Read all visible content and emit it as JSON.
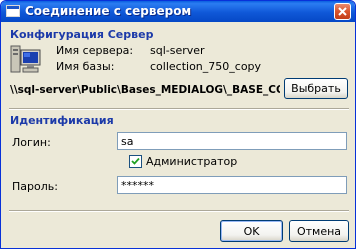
{
  "window": {
    "title": "Соединение с сервером"
  },
  "config": {
    "section_title": "Конфигурация Сервер",
    "server_label": "Имя сервера:",
    "server_value": "sql-server",
    "db_label": "Имя базы:",
    "db_value": "collection_750_copy",
    "path": "\\\\sql-server\\Public\\Bases_MEDIALOG\\_BASE_COLLECTION_",
    "browse_label": "Выбрать"
  },
  "auth": {
    "section_title": "Идентификация",
    "login_label": "Логин:",
    "login_value": "sa",
    "admin_label": "Администратор",
    "admin_checked": true,
    "password_label": "Пароль:",
    "password_value": "******"
  },
  "buttons": {
    "ok_label": "OK",
    "cancel_label": "Отмена"
  },
  "colors": {
    "title_bar": "#0a5fe0",
    "section_title": "#1c3aa9",
    "dialog_bg": "#ece9d8"
  },
  "icons": [
    "window-icon",
    "close-icon",
    "computer-icon",
    "checkmark-icon"
  ]
}
